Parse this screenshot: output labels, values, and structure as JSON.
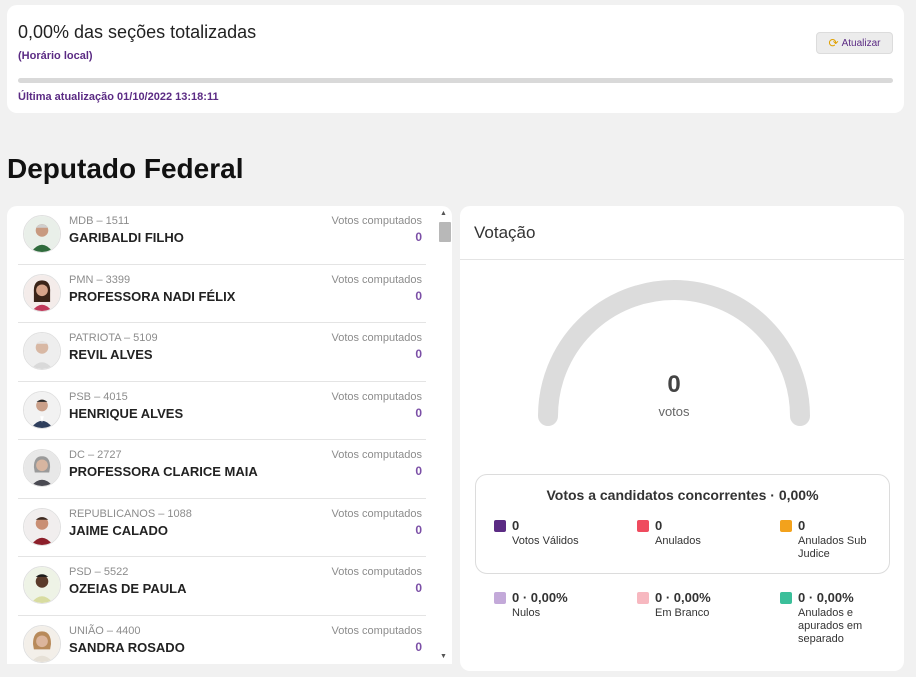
{
  "status": {
    "title": "0,00% das seções totalizadas",
    "local_time": "(Horário local)",
    "refresh_label": "Atualizar",
    "progress_pct": 0,
    "last_update": "Última atualização 01/10/2022 13:18:11"
  },
  "section_title": "Deputado Federal",
  "candidates": [
    {
      "party": "MDB – 1511",
      "name": "GARIBALDI FILHO",
      "votes_label": "Votos computados",
      "votes": "0"
    },
    {
      "party": "PMN – 3399",
      "name": "PROFESSORA NADI FÉLIX",
      "votes_label": "Votos computados",
      "votes": "0"
    },
    {
      "party": "PATRIOTA – 5109",
      "name": "REVIL ALVES",
      "votes_label": "Votos computados",
      "votes": "0"
    },
    {
      "party": "PSB – 4015",
      "name": "HENRIQUE ALVES",
      "votes_label": "Votos computados",
      "votes": "0"
    },
    {
      "party": "DC – 2727",
      "name": "PROFESSORA CLARICE MAIA",
      "votes_label": "Votos computados",
      "votes": "0"
    },
    {
      "party": "REPUBLICANOS – 1088",
      "name": "JAIME CALADO",
      "votes_label": "Votos computados",
      "votes": "0"
    },
    {
      "party": "PSD – 5522",
      "name": "OZEIAS DE PAULA",
      "votes_label": "Votos computados",
      "votes": "0"
    },
    {
      "party": "UNIÃO – 4400",
      "name": "SANDRA ROSADO",
      "votes_label": "Votos computados",
      "votes": "0"
    }
  ],
  "voting": {
    "header": "Votação",
    "total": "0",
    "unit": "votos",
    "summary_title": "Votos a candidatos concorrentes · 0,00%",
    "stats": [
      {
        "value": "0",
        "label": "Votos Válidos",
        "color": "#5b2b84"
      },
      {
        "value": "0",
        "label": "Anulados",
        "color": "#ef4b5e"
      },
      {
        "value": "0",
        "label": "Anulados Sub Judice",
        "color": "#f3a21c"
      },
      {
        "value": "0 · 0,00%",
        "label": "Nulos",
        "color": "#c3a9d9"
      },
      {
        "value": "0 · 0,00%",
        "label": "Em Branco",
        "color": "#f7b8c0"
      },
      {
        "value": "0 · 0,00%",
        "label": "Anulados e apurados em separado",
        "color": "#3bbf9a"
      }
    ]
  }
}
